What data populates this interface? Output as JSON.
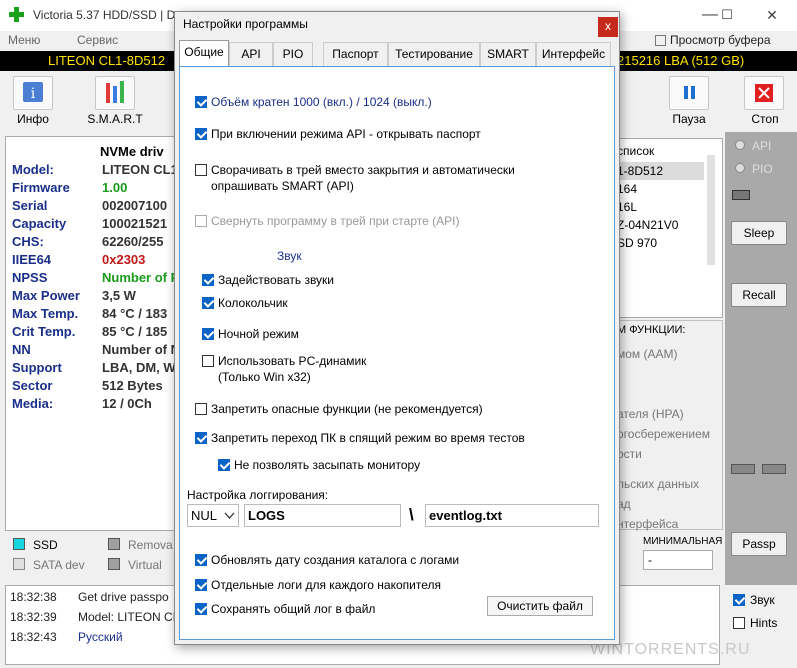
{
  "window": {
    "title": "Victoria 5.37 HDD/SSD | De",
    "minimize": "—",
    "maximize": "☐",
    "close": "✕"
  },
  "menu": {
    "items": [
      "Меню",
      "Сервис"
    ],
    "buffer_view": "Просмотр буфера"
  },
  "drive_bar": {
    "left": "LITEON CL1-8D512",
    "right": "215216 LBA (512 GB)"
  },
  "toolbar": {
    "info": "Инфо",
    "smart": "S.M.A.R.T",
    "pause": "Пауза",
    "stop": "Стоп"
  },
  "drive_info": {
    "header": "NVMe driv",
    "rows": [
      {
        "label": "Model:",
        "value": "LITEON CL1-"
      },
      {
        "label": "Firmware",
        "value": "1.00",
        "color": "#1a9a1a"
      },
      {
        "label": "Serial",
        "value": "002007100"
      },
      {
        "label": "Capacity",
        "value": "100021521"
      },
      {
        "label": "CHS:",
        "value": "62260/255"
      },
      {
        "label": "IIEE64",
        "value": "0x2303",
        "color": "#c01818"
      },
      {
        "label": "NPSS",
        "value": "Number of P",
        "color": "#1a9a1a"
      },
      {
        "label": "Max Power",
        "value": "3,5 W"
      },
      {
        "label": "Max Temp.",
        "value": "84 °C / 183"
      },
      {
        "label": "Crit Temp.",
        "value": "85 °C / 185"
      },
      {
        "label": "NN",
        "value": "Number of N"
      },
      {
        "label": "Support",
        "value": "LBA, DM, W"
      },
      {
        "label": "Sector",
        "value": "512 Bytes"
      },
      {
        "label": "Media:",
        "value": "12 / 0Ch"
      }
    ]
  },
  "legend": {
    "ssd": "SSD",
    "removable": "Remova",
    "sata_dev": "SATA dev",
    "virtual": "Virtual"
  },
  "drive_list": {
    "header": "список",
    "items": [
      "1-8D512",
      "164",
      "16L",
      "Z-04N21V0",
      "SD 970"
    ]
  },
  "mode": {
    "api": "API",
    "pio": "PIO"
  },
  "right_buttons": {
    "sleep": "Sleep",
    "recall": "Recall",
    "passp": "Passp"
  },
  "functions": {
    "header": "М ФУНКЦИИ:",
    "items": [
      "мом (AAM)",
      "ателя (HPA)",
      "огосбережением",
      "ости",
      "льских данных",
      "ад",
      "нтерфейса"
    ]
  },
  "min_label": "МИНИМАЛЬНАЯ",
  "min_value": "-",
  "log": [
    {
      "time": "18:32:38",
      "msg": "Get drive passpo"
    },
    {
      "time": "18:32:39",
      "msg": "Model: LITEON CL"
    },
    {
      "time": "18:32:43",
      "msg": "Русский",
      "color": "#1a2f8a"
    }
  ],
  "side_checks": {
    "sound": "Звук",
    "hints": "Hints"
  },
  "watermark": "WINTORRENTS.RU",
  "dialog": {
    "title": "Настройки программы",
    "close": "x",
    "tabs": [
      "Общие",
      "API",
      "PIO",
      "Паспорт",
      "Тестирование",
      "SMART",
      "Интерфейс"
    ],
    "opt_volume": "Объём кратен 1000 (вкл.) / 1024 (выкл.)",
    "opt_api_passport": "При включении режима API - открывать паспорт",
    "opt_tray_line1": "Сворачивать в трей вместо закрытия и автоматически",
    "opt_tray_line2": "опрашивать SMART (API)",
    "opt_tray_start": "Свернуть программу в трей при старте (API)",
    "sound_header": "Звук",
    "opt_sounds": "Задействовать звуки",
    "opt_bell": "Колокольчик",
    "opt_night": "Ночной режим",
    "opt_pc_speaker_line1": "Использовать PC-динамик",
    "opt_pc_speaker_line2": "(Только Win x32)",
    "opt_forbid_danger": "Запретить опасные функции (не рекомендуется)",
    "opt_forbid_sleep": "Запретить переход ПК в спящий режим во время тестов",
    "opt_no_monitor_sleep": "Не позволять засыпать монитору",
    "logging_label": "Настройка логгирования:",
    "log_drive": "NUL",
    "log_folder": "LOGS",
    "log_sep": "\\",
    "log_file": "eventlog.txt",
    "opt_update_date": "Обновлять дату создания каталога с логами",
    "opt_separate_logs": "Отдельные логи для каждого накопителя",
    "opt_save_common": "Сохранять общий лог в файл",
    "clear_button": "Очистить файл"
  },
  "colors": {
    "accent": "#0a64c8",
    "dialog_border": "#5b9bd5",
    "drive_bar_text": "#ffe400",
    "close_red": "#c42b1c"
  }
}
